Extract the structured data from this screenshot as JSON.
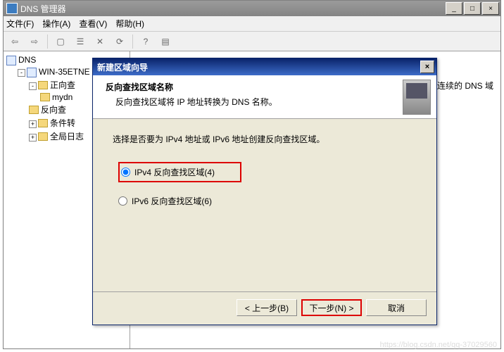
{
  "main_window": {
    "title": "DNS 管理器",
    "menu": {
      "file": "文件(F)",
      "action": "操作(A)",
      "view": "查看(V)",
      "help": "帮助(H)"
    }
  },
  "tree": {
    "root": "DNS",
    "server": "WIN-35ETNE",
    "forward": "正向查",
    "mydn": "mydn",
    "reverse": "反向查",
    "cond": "条件转",
    "global": "全局日志"
  },
  "content": {
    "hint": "多个连续的 DNS 域"
  },
  "dialog": {
    "title": "新建区域向导",
    "header_title": "反向查找区域名称",
    "header_sub": "反向查找区域将 IP 地址转换为 DNS 名称。",
    "prompt": "选择是否要为 IPv4 地址或 IPv6 地址创建反向查找区域。",
    "radio_ipv4": "IPv4 反向查找区域(4)",
    "radio_ipv6": "IPv6 反向查找区域(6)",
    "back": "< 上一步(B)",
    "next": "下一步(N) >",
    "cancel": "取消"
  },
  "watermark": "https://blog.csdn.net/qq-37029560"
}
